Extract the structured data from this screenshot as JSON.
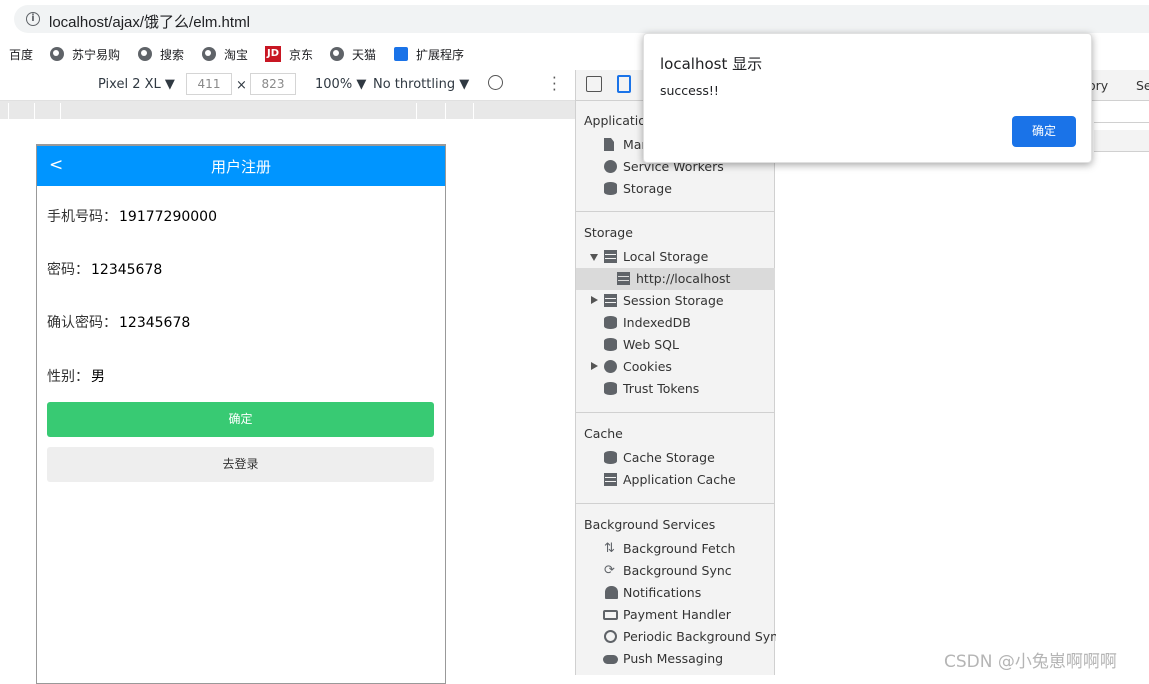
{
  "browser": {
    "url": "localhost/ajax/饿了么/elm.html",
    "bookmarks": [
      "百度",
      "苏宁易购",
      "搜索",
      "淘宝",
      "京东",
      "天猫",
      "扩展程序"
    ],
    "jd_logo_text": "JD"
  },
  "device_toolbar": {
    "device": "Pixel 2 XL",
    "width": "411",
    "times": "×",
    "height": "823",
    "zoom": "100%",
    "throttle": "No throttling"
  },
  "app": {
    "back": "<",
    "title": "用户注册",
    "fields": [
      {
        "label": "手机号码：",
        "value": "19177290000"
      },
      {
        "label": "密码：",
        "value": "12345678"
      },
      {
        "label": "确认密码：",
        "value": "12345678"
      },
      {
        "label": "性别：",
        "value": "男"
      }
    ],
    "confirm_button": "确定",
    "login_button": "去登录"
  },
  "devtools": {
    "tabs_visible": [
      "ory",
      "Se"
    ],
    "sections": {
      "application": {
        "title": "Applicatio",
        "items": [
          "Mar",
          "Service Workers",
          "Storage"
        ]
      },
      "storage": {
        "title": "Storage",
        "items": [
          "Local Storage",
          "http://localhost",
          "Session Storage",
          "IndexedDB",
          "Web SQL",
          "Cookies",
          "Trust Tokens"
        ]
      },
      "cache": {
        "title": "Cache",
        "items": [
          "Cache Storage",
          "Application Cache"
        ]
      },
      "background": {
        "title": "Background Services",
        "items": [
          "Background Fetch",
          "Background Sync",
          "Notifications",
          "Payment Handler",
          "Periodic Background Sync",
          "Push Messaging"
        ]
      }
    }
  },
  "dialog": {
    "title": "localhost 显示",
    "message": "success!!",
    "ok": "确定"
  },
  "watermark": "CSDN @小兔崽啊啊啊",
  "colors": {
    "app_header": "#0095ff",
    "confirm_button": "#38ca73",
    "dialog_button": "#1a73e8"
  }
}
